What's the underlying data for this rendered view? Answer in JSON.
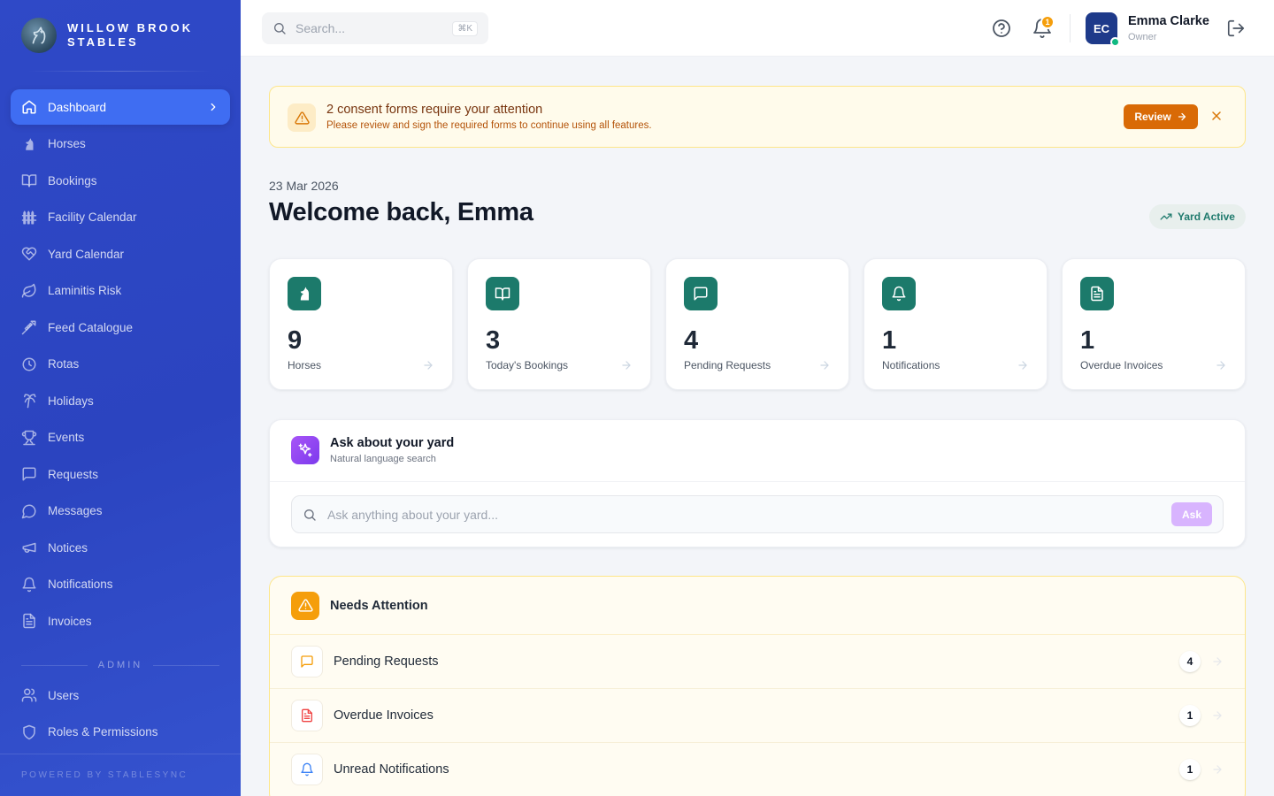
{
  "brand": {
    "name": "WILLOW BROOK STABLES"
  },
  "nav": {
    "items": [
      {
        "label": "Dashboard",
        "icon": "home-icon",
        "active": true
      },
      {
        "label": "Horses",
        "icon": "horse-icon"
      },
      {
        "label": "Bookings",
        "icon": "book-icon"
      },
      {
        "label": "Facility Calendar",
        "icon": "fence-icon"
      },
      {
        "label": "Yard Calendar",
        "icon": "heart-handshake-icon"
      },
      {
        "label": "Laminitis Risk",
        "icon": "leaf-icon"
      },
      {
        "label": "Feed Catalogue",
        "icon": "wheat-icon"
      },
      {
        "label": "Rotas",
        "icon": "clock-icon"
      },
      {
        "label": "Holidays",
        "icon": "palm-tree-icon"
      },
      {
        "label": "Events",
        "icon": "trophy-icon"
      },
      {
        "label": "Requests",
        "icon": "message-square-icon"
      },
      {
        "label": "Messages",
        "icon": "message-circle-icon"
      },
      {
        "label": "Notices",
        "icon": "megaphone-icon"
      },
      {
        "label": "Notifications",
        "icon": "bell-icon"
      },
      {
        "label": "Invoices",
        "icon": "file-text-icon"
      }
    ],
    "admin_label": "ADMIN",
    "admin_items": [
      {
        "label": "Users",
        "icon": "users-icon"
      },
      {
        "label": "Roles & Permissions",
        "icon": "shield-icon"
      }
    ],
    "powered_by": "POWERED BY STABLESYNC"
  },
  "topbar": {
    "search_placeholder": "Search...",
    "search_shortcut": "⌘K",
    "notification_count": "1",
    "user": {
      "initials": "EC",
      "name": "Emma Clarke",
      "role": "Owner"
    }
  },
  "alert": {
    "title": "2 consent forms require your attention",
    "subtitle": "Please review and sign the required forms to continue using all features.",
    "button": "Review"
  },
  "header": {
    "date": "23 Mar 2026",
    "welcome": "Welcome back, Emma",
    "status": "Yard Active"
  },
  "stats": [
    {
      "value": "9",
      "label": "Horses",
      "icon": "horse-icon"
    },
    {
      "value": "3",
      "label": "Today's Bookings",
      "icon": "book-icon"
    },
    {
      "value": "4",
      "label": "Pending Requests",
      "icon": "message-square-icon"
    },
    {
      "value": "1",
      "label": "Notifications",
      "icon": "bell-icon"
    },
    {
      "value": "1",
      "label": "Overdue Invoices",
      "icon": "file-text-icon"
    }
  ],
  "ask": {
    "title": "Ask about your yard",
    "subtitle": "Natural language search",
    "placeholder": "Ask anything about your yard...",
    "button": "Ask"
  },
  "attention": {
    "title": "Needs Attention",
    "rows": [
      {
        "label": "Pending Requests",
        "count": "4",
        "icon": "message-square-icon",
        "color": "#f59e0b"
      },
      {
        "label": "Overdue Invoices",
        "count": "1",
        "icon": "file-text-icon",
        "color": "#ef4444"
      },
      {
        "label": "Unread Notifications",
        "count": "1",
        "icon": "bell-icon",
        "color": "#3b82f6"
      }
    ]
  },
  "colors": {
    "sidebar": "#2f49c7",
    "accent": "#3f6df2",
    "stat_icon": "#1c7a6b",
    "warning": "#d96a06"
  }
}
